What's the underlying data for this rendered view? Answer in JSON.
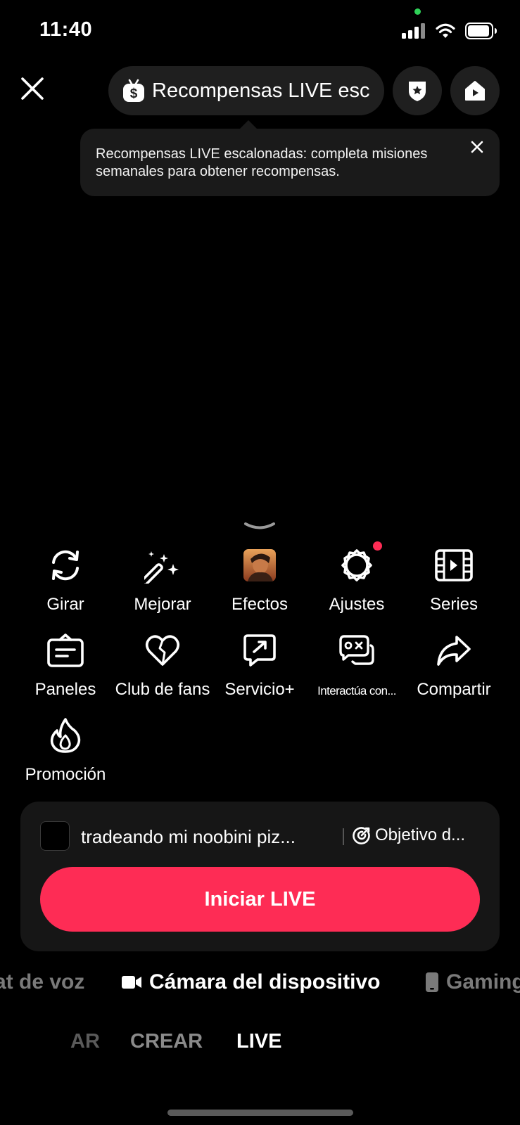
{
  "status_bar": {
    "time": "11:40"
  },
  "header": {
    "rewards_pill_label": "Recompensas LIVE esc",
    "icons": [
      "close-icon",
      "dollar-badge-icon",
      "shield-star-icon",
      "home-play-icon"
    ]
  },
  "tooltip": {
    "text": "Recompensas LIVE escalonadas: completa misiones semanales para obtener recompensas."
  },
  "tools": [
    {
      "label": "Girar",
      "icon": "rotate-icon"
    },
    {
      "label": "Mejorar",
      "icon": "magic-wand-icon"
    },
    {
      "label": "Efectos",
      "icon": "effects-thumbnail"
    },
    {
      "label": "Ajustes",
      "icon": "gear-icon",
      "badge": "red-dot"
    },
    {
      "label": "Series",
      "icon": "film-icon"
    },
    {
      "label": "Paneles",
      "icon": "panel-icon"
    },
    {
      "label": "Club de fans",
      "icon": "heart-icon"
    },
    {
      "label": "Servicio+",
      "icon": "share-box-icon"
    },
    {
      "label": "Interactúa con...",
      "icon": "game-chat-icon"
    },
    {
      "label": "Compartir",
      "icon": "share-arrow-icon"
    },
    {
      "label": "Promoción",
      "icon": "flame-icon"
    }
  ],
  "live_panel": {
    "title": "tradeando mi noobini piz...",
    "goal_label": "Objetivo d...",
    "start_button": "Iniciar LIVE"
  },
  "source_tabs": {
    "left": "at de voz",
    "center": "Cámara del dispositivo",
    "right": "Gaming"
  },
  "mode_tabs": {
    "left": "AR",
    "middle": "CREAR",
    "active": "LIVE"
  },
  "colors": {
    "accent": "#fe2c55",
    "online": "#2fd158",
    "panel": "#161616",
    "pill": "#1f1f1f"
  }
}
